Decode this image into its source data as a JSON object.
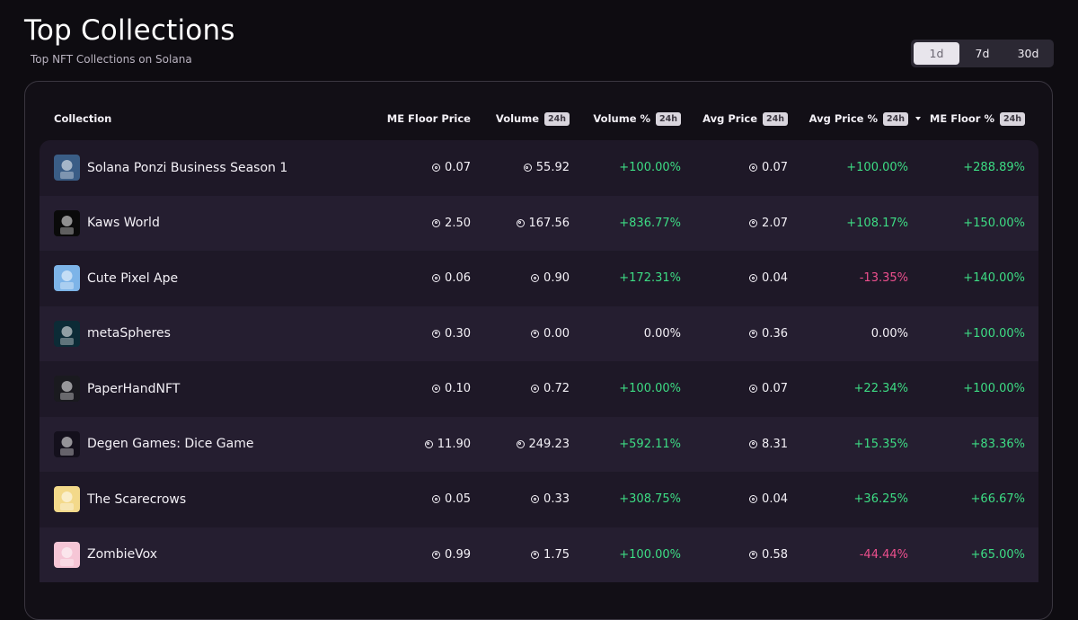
{
  "header": {
    "title": "Top Collections",
    "subtitle": "Top NFT Collections on Solana"
  },
  "period": {
    "options": [
      "1d",
      "7d",
      "30d"
    ],
    "selected": "1d"
  },
  "table": {
    "columns": {
      "collection": "Collection",
      "floor": "ME Floor Price",
      "volume": "Volume",
      "volume_badge": "24h",
      "volume_pct": "Volume %",
      "volume_pct_badge": "24h",
      "avg_price": "Avg Price",
      "avg_price_badge": "24h",
      "avg_price_pct": "Avg Price %",
      "avg_price_pct_badge": "24h",
      "floor_pct": "ME Floor %",
      "floor_pct_badge": "24h"
    },
    "rows": [
      {
        "name": "Solana Ponzi Business Season 1",
        "floor": "0.07",
        "volume": "55.92",
        "volume_pct": "+100.00%",
        "volume_trend": "pos",
        "avg_price": "0.07",
        "avg_price_pct": "+100.00%",
        "avg_trend": "pos",
        "floor_pct": "+288.89%",
        "floor_trend": "pos",
        "icon": "ponzi-business-avatar",
        "color": "#3a5d86"
      },
      {
        "name": "Kaws World",
        "floor": "2.50",
        "volume": "167.56",
        "volume_pct": "+836.77%",
        "volume_trend": "pos",
        "avg_price": "2.07",
        "avg_price_pct": "+108.17%",
        "avg_trend": "pos",
        "floor_pct": "+150.00%",
        "floor_trend": "pos",
        "icon": "kaws-skull-avatar",
        "color": "#0a0a0a"
      },
      {
        "name": "Cute Pixel Ape",
        "floor": "0.06",
        "volume": "0.90",
        "volume_pct": "+172.31%",
        "volume_trend": "pos",
        "avg_price": "0.04",
        "avg_price_pct": "-13.35%",
        "avg_trend": "neg",
        "floor_pct": "+140.00%",
        "floor_trend": "pos",
        "icon": "pixel-ape-avatar",
        "color": "#7db4e8"
      },
      {
        "name": "metaSpheres",
        "floor": "0.30",
        "volume": "0.00",
        "volume_pct": "0.00%",
        "volume_trend": "neu",
        "avg_price": "0.36",
        "avg_price_pct": "0.00%",
        "avg_trend": "neu",
        "floor_pct": "+100.00%",
        "floor_trend": "pos",
        "icon": "sphere-avatar",
        "color": "#0c2b36"
      },
      {
        "name": "PaperHandNFT",
        "floor": "0.10",
        "volume": "0.72",
        "volume_pct": "+100.00%",
        "volume_trend": "pos",
        "avg_price": "0.07",
        "avg_price_pct": "+22.34%",
        "avg_trend": "pos",
        "floor_pct": "+100.00%",
        "floor_trend": "pos",
        "icon": "paper-hand-avatar",
        "color": "#1a1a1f"
      },
      {
        "name": "Degen Games: Dice Game",
        "floor": "11.90",
        "volume": "249.23",
        "volume_pct": "+592.11%",
        "volume_trend": "pos",
        "avg_price": "8.31",
        "avg_price_pct": "+15.35%",
        "avg_trend": "pos",
        "floor_pct": "+83.36%",
        "floor_trend": "pos",
        "icon": "dice-avatar",
        "color": "#14101c"
      },
      {
        "name": "The Scarecrows",
        "floor": "0.05",
        "volume": "0.33",
        "volume_pct": "+308.75%",
        "volume_trend": "pos",
        "avg_price": "0.04",
        "avg_price_pct": "+36.25%",
        "avg_trend": "pos",
        "floor_pct": "+66.67%",
        "floor_trend": "pos",
        "icon": "scarecrow-avatar",
        "color": "#f3d98a"
      },
      {
        "name": "ZombieVox",
        "floor": "0.99",
        "volume": "1.75",
        "volume_pct": "+100.00%",
        "volume_trend": "pos",
        "avg_price": "0.58",
        "avg_price_pct": "-44.44%",
        "avg_trend": "neg",
        "floor_pct": "+65.00%",
        "floor_trend": "pos",
        "icon": "zombie-avatar",
        "color": "#f6c6d6"
      }
    ]
  },
  "colors": {
    "positive": "#3ddc84",
    "negative": "#ec4f8d",
    "background": "#0e0c11"
  }
}
